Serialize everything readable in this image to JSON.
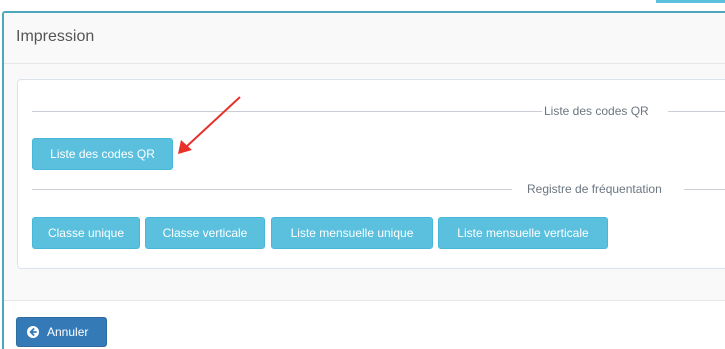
{
  "panel": {
    "title": "Impression"
  },
  "sections": {
    "qr": {
      "legend": "Liste des codes QR",
      "buttons": [
        {
          "label": "Liste des codes QR"
        }
      ]
    },
    "attendance": {
      "legend": "Registre de fréquentation",
      "buttons": [
        {
          "label": "Classe unique"
        },
        {
          "label": "Classe verticale"
        },
        {
          "label": "Liste mensuelle unique"
        },
        {
          "label": "Liste mensuelle verticale"
        }
      ]
    }
  },
  "footer": {
    "cancel_label": "Annuler",
    "cancel_icon": "arrow-circle-left-icon"
  },
  "annotation": {
    "arrow_color": "#e8312b"
  },
  "colors": {
    "info_button": "#5bc0de",
    "primary_button": "#337ab7",
    "panel_border": "#4ea8bd"
  }
}
